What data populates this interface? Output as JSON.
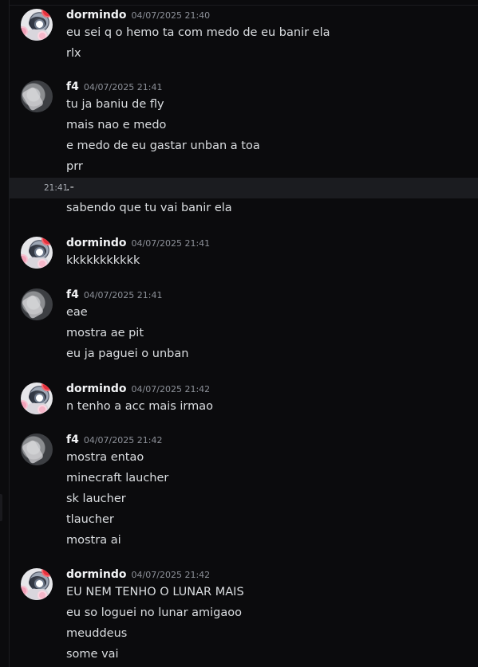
{
  "messages": [
    {
      "author": "dormindo",
      "time": "04/07/2025 21:40",
      "lines": [
        "eu sei q o hemo ta com medo de eu banir ela",
        "rlx"
      ]
    },
    {
      "author": "f4",
      "time": "04/07/2025 21:41",
      "lines": [
        "tu ja baniu de fly",
        "mais nao e medo",
        "e medo de eu gastar unban a toa",
        "prr"
      ],
      "hover_time": "21:41",
      "hover_line": ".-",
      "extra_line": "sabendo que tu vai banir ela"
    },
    {
      "author": "dormindo",
      "time": "04/07/2025 21:41",
      "lines": [
        "kkkkkkkkkkk"
      ]
    },
    {
      "author": "f4",
      "time": "04/07/2025 21:41",
      "lines": [
        "eae",
        "mostra ae pit",
        "eu ja paguei o unban"
      ]
    },
    {
      "author": "dormindo",
      "time": "04/07/2025 21:42",
      "lines": [
        "n tenho a acc mais irmao"
      ]
    },
    {
      "author": "f4",
      "time": "04/07/2025 21:42",
      "lines": [
        "mostra entao",
        "minecraft laucher",
        "sk laucher",
        "tlaucher",
        "mostra ai"
      ]
    },
    {
      "author": "dormindo",
      "time": "04/07/2025 21:42",
      "lines": [
        "EU NEM TENHO O LUNAR MAIS",
        "eu so loguei no lunar amigaoo",
        "meuddeus",
        "some vai"
      ]
    }
  ]
}
